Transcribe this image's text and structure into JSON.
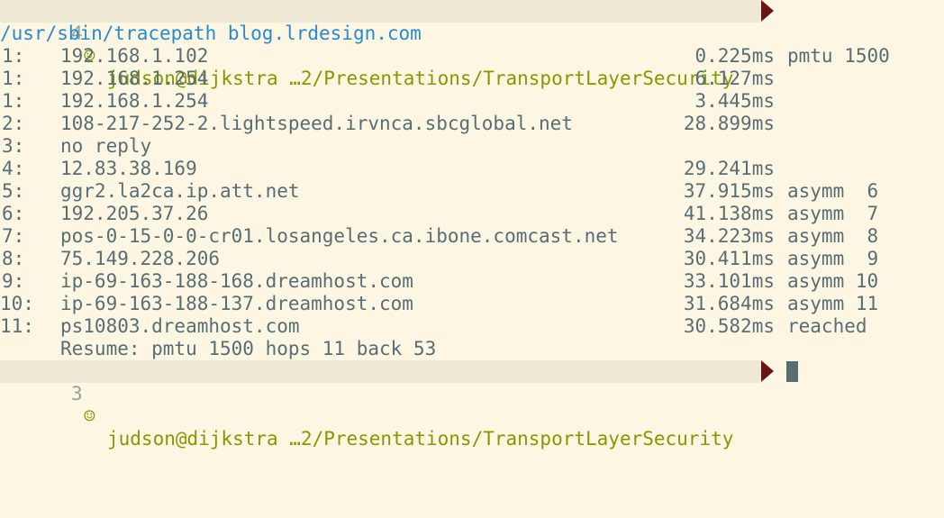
{
  "prompt_top": {
    "num": "4",
    "smiley": "☺",
    "text": "judson@dijkstra …2/Presentations/TransportLayerSecurity"
  },
  "command": {
    "path": "/usr/sbin/tracepath",
    "arg": "blog.lrdesign.com"
  },
  "rows": [
    {
      "hop": "1:",
      "host": "192.168.1.102",
      "rtt": "0.225ms",
      "extra": "pmtu 1500"
    },
    {
      "hop": "1:",
      "host": "192.168.1.254",
      "rtt": "6.127ms",
      "extra": ""
    },
    {
      "hop": "1:",
      "host": "192.168.1.254",
      "rtt": "3.445ms",
      "extra": ""
    },
    {
      "hop": "2:",
      "host": "108-217-252-2.lightspeed.irvnca.sbcglobal.net",
      "rtt": "28.899ms",
      "extra": ""
    },
    {
      "hop": "3:",
      "host": "no reply",
      "rtt": "",
      "extra": ""
    },
    {
      "hop": "4:",
      "host": "12.83.38.169",
      "rtt": "29.241ms",
      "extra": ""
    },
    {
      "hop": "5:",
      "host": "ggr2.la2ca.ip.att.net",
      "rtt": "37.915ms",
      "extra": "asymm  6"
    },
    {
      "hop": "6:",
      "host": "192.205.37.26",
      "rtt": "41.138ms",
      "extra": "asymm  7"
    },
    {
      "hop": "7:",
      "host": "pos-0-15-0-0-cr01.losangeles.ca.ibone.comcast.net",
      "rtt": "34.223ms",
      "extra": "asymm  8"
    },
    {
      "hop": "8:",
      "host": "75.149.228.206",
      "rtt": "30.411ms",
      "extra": "asymm  9"
    },
    {
      "hop": "9:",
      "host": "ip-69-163-188-168.dreamhost.com",
      "rtt": "33.101ms",
      "extra": "asymm 10"
    },
    {
      "hop": "10:",
      "host": "ip-69-163-188-137.dreamhost.com",
      "rtt": "31.684ms",
      "extra": "asymm 11"
    },
    {
      "hop": "11:",
      "host": "ps10803.dreamhost.com",
      "rtt": "30.582ms",
      "extra": "reached"
    }
  ],
  "summary": "Resume: pmtu 1500 hops 11 back 53",
  "prompt_bottom": {
    "num": "3",
    "smiley": "☺",
    "text": "judson@dijkstra …2/Presentations/TransportLayerSecurity"
  }
}
